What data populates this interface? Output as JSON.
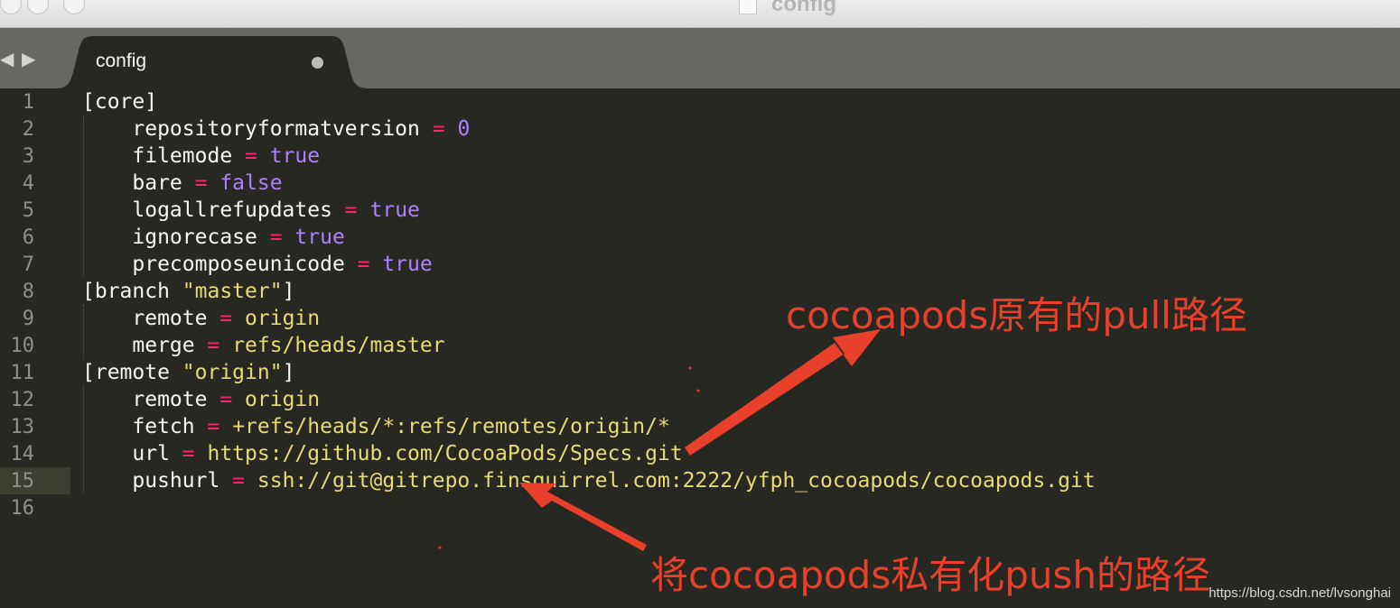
{
  "window": {
    "title": "config"
  },
  "tab": {
    "label": "config"
  },
  "lines": [
    {
      "n": "1",
      "parts": [
        {
          "t": "[core]",
          "c": "k"
        }
      ]
    },
    {
      "n": "2",
      "parts": [
        {
          "t": "    repositoryformatversion ",
          "c": "k"
        },
        {
          "t": "=",
          "c": "op"
        },
        {
          "t": " 0",
          "c": "num"
        }
      ]
    },
    {
      "n": "3",
      "parts": [
        {
          "t": "    filemode ",
          "c": "k"
        },
        {
          "t": "=",
          "c": "op"
        },
        {
          "t": " true",
          "c": "num"
        }
      ]
    },
    {
      "n": "4",
      "parts": [
        {
          "t": "    bare ",
          "c": "k"
        },
        {
          "t": "=",
          "c": "op"
        },
        {
          "t": " false",
          "c": "num"
        }
      ]
    },
    {
      "n": "5",
      "parts": [
        {
          "t": "    logallrefupdates ",
          "c": "k"
        },
        {
          "t": "=",
          "c": "op"
        },
        {
          "t": " true",
          "c": "num"
        }
      ]
    },
    {
      "n": "6",
      "parts": [
        {
          "t": "    ignorecase ",
          "c": "k"
        },
        {
          "t": "=",
          "c": "op"
        },
        {
          "t": " true",
          "c": "num"
        }
      ]
    },
    {
      "n": "7",
      "parts": [
        {
          "t": "    precomposeunicode ",
          "c": "k"
        },
        {
          "t": "=",
          "c": "op"
        },
        {
          "t": " true",
          "c": "num"
        }
      ]
    },
    {
      "n": "8",
      "parts": [
        {
          "t": "[branch ",
          "c": "k"
        },
        {
          "t": "\"master\"",
          "c": "str"
        },
        {
          "t": "]",
          "c": "k"
        }
      ]
    },
    {
      "n": "9",
      "parts": [
        {
          "t": "    remote ",
          "c": "k"
        },
        {
          "t": "=",
          "c": "op"
        },
        {
          "t": " origin",
          "c": "str"
        }
      ]
    },
    {
      "n": "10",
      "parts": [
        {
          "t": "    merge ",
          "c": "k"
        },
        {
          "t": "=",
          "c": "op"
        },
        {
          "t": " refs/heads/master",
          "c": "str"
        }
      ]
    },
    {
      "n": "11",
      "parts": [
        {
          "t": "[remote ",
          "c": "k"
        },
        {
          "t": "\"origin\"",
          "c": "str"
        },
        {
          "t": "]",
          "c": "k"
        }
      ]
    },
    {
      "n": "12",
      "parts": [
        {
          "t": "    remote ",
          "c": "k"
        },
        {
          "t": "=",
          "c": "op"
        },
        {
          "t": " origin",
          "c": "str"
        }
      ]
    },
    {
      "n": "13",
      "parts": [
        {
          "t": "    fetch ",
          "c": "k"
        },
        {
          "t": "=",
          "c": "op"
        },
        {
          "t": " +refs/heads/*:refs/remotes/origin/*",
          "c": "str"
        }
      ]
    },
    {
      "n": "14",
      "parts": [
        {
          "t": "    url ",
          "c": "k"
        },
        {
          "t": "=",
          "c": "op"
        },
        {
          "t": " https://github.com/CocoaPods/Specs.git",
          "c": "str"
        }
      ]
    },
    {
      "n": "15",
      "parts": [
        {
          "t": "    pushurl ",
          "c": "k"
        },
        {
          "t": "=",
          "c": "op"
        },
        {
          "t": " ssh://git@gitrepo.finsquirrel.com:2222/yfph_cocoapods/cocoapods.git",
          "c": "str"
        }
      ],
      "active": true
    },
    {
      "n": "16",
      "parts": []
    }
  ],
  "annotations": {
    "pull": "cocoapods原有的pull路径",
    "push": "将cocoapods私有化push的路径"
  },
  "watermark": "https://blog.csdn.net/lvsonghai",
  "colors": {
    "background": "#272822",
    "keyword": "#f8f8f2",
    "operator": "#f92672",
    "constant": "#ae81ff",
    "string": "#e6db74",
    "annotation": "#e8402b"
  }
}
